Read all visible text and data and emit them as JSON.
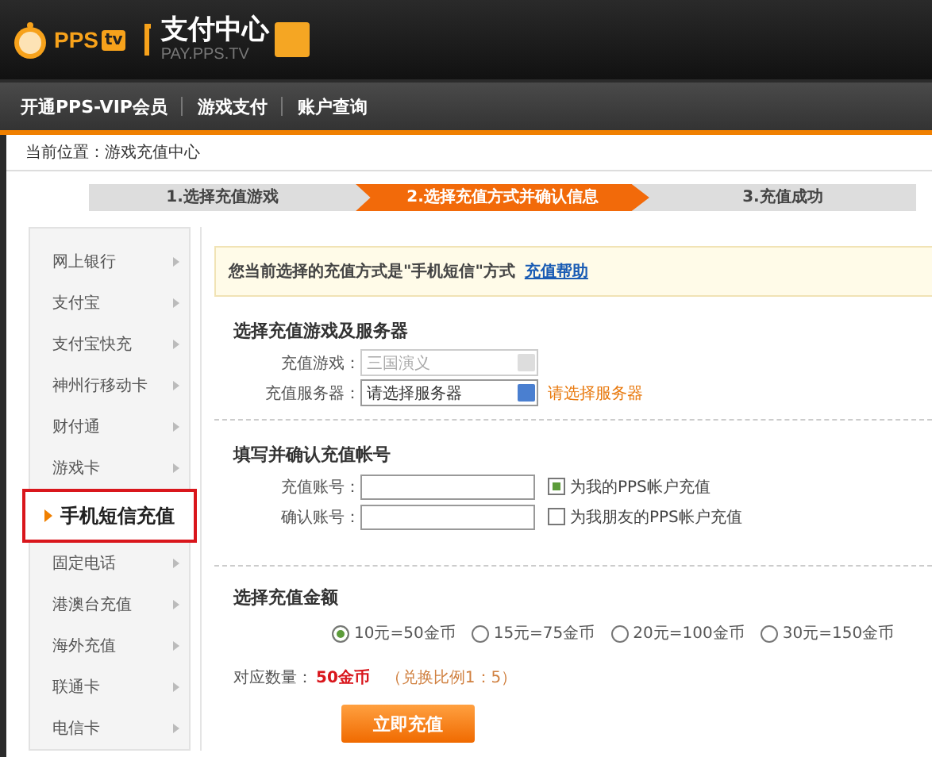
{
  "header": {
    "logo_text": "PPS",
    "logo_badge": "tv",
    "title": "支付中心",
    "subtitle": "PAY.PPS.TV"
  },
  "nav": [
    {
      "label": "开通PPS-VIP会员"
    },
    {
      "label": "游戏支付"
    },
    {
      "label": "账户查询"
    }
  ],
  "breadcrumb": "当前位置：游戏充值中心",
  "steps": [
    {
      "label": "1.选择充值游戏",
      "selected": false
    },
    {
      "label": "2.选择充值方式并确认信息",
      "selected": true
    },
    {
      "label": "3.充值成功",
      "selected": false
    }
  ],
  "sidebar": {
    "items": [
      {
        "label": "网上银行",
        "selected": false
      },
      {
        "label": "支付宝",
        "selected": false
      },
      {
        "label": "支付宝快充",
        "selected": false
      },
      {
        "label": "神州行移动卡",
        "selected": false
      },
      {
        "label": "财付通",
        "selected": false
      },
      {
        "label": "游戏卡",
        "selected": false
      },
      {
        "label": "手机短信充值",
        "selected": true
      },
      {
        "label": "固定电话",
        "selected": false
      },
      {
        "label": "港澳台充值",
        "selected": false
      },
      {
        "label": "海外充值",
        "selected": false
      },
      {
        "label": "联通卡",
        "selected": false
      },
      {
        "label": "电信卡",
        "selected": false
      }
    ]
  },
  "notice": {
    "text": "您当前选择的充值方式是\"手机短信\"方式",
    "link": "充值帮助"
  },
  "game_section": {
    "title": "选择充值游戏及服务器",
    "fields": [
      {
        "label": "充值游戏：",
        "value": "三国演义",
        "disabled": true
      },
      {
        "label": "充值服务器：",
        "value": "请选择服务器",
        "disabled": false,
        "hint": "请选择服务器"
      }
    ]
  },
  "account_section": {
    "title": "填写并确认充值帐号",
    "fields": [
      {
        "label": "充值账号：",
        "option": "为我的PPS帐户充值",
        "checked": true
      },
      {
        "label": "确认账号：",
        "option": "为我朋友的PPS帐户充值",
        "checked": false
      }
    ]
  },
  "amount_section": {
    "title": "选择充值金额",
    "options": [
      {
        "label": "10元=50金币",
        "selected": true
      },
      {
        "label": "15元=75金币",
        "selected": false
      },
      {
        "label": "20元=100金币",
        "selected": false
      },
      {
        "label": "30元=150金币",
        "selected": false
      }
    ],
    "summary_label": "对应数量：",
    "summary_value": "50金币",
    "ratio": "（兑换比例1：5）"
  },
  "submit_button": "立即充值"
}
